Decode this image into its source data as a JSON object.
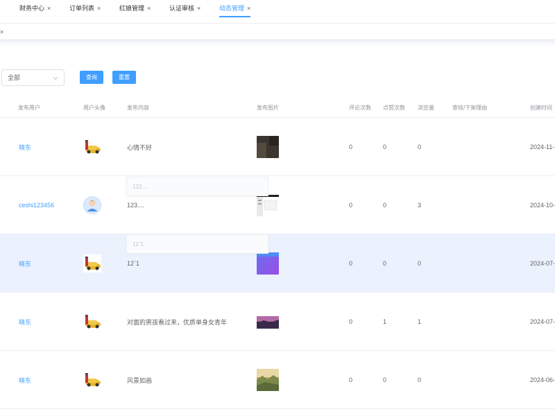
{
  "tabs": [
    {
      "label": "财务中心",
      "active": false
    },
    {
      "label": "订单列表",
      "active": false
    },
    {
      "label": "红娘管理",
      "active": false
    },
    {
      "label": "认证审核",
      "active": false
    },
    {
      "label": "动态管理",
      "active": true
    }
  ],
  "tab_close_glyph": "×",
  "filter": {
    "select_value": "全部",
    "query_button": "查询",
    "reset_button": "重置"
  },
  "table": {
    "headers": {
      "user": "发布用户",
      "avatar": "用户头像",
      "content": "发布内容",
      "images": "发布图片",
      "comments": "评论次数",
      "likes": "点赞次数",
      "views": "浏览量",
      "audit_reason": "审核/下架理由",
      "created": "创建时间"
    },
    "rows": [
      {
        "user": "晓东",
        "avatar": "car-avatar",
        "content": "心情不好",
        "image": "dark-photo",
        "comments": "0",
        "likes": "0",
        "views": "0",
        "created": "2024-11-"
      },
      {
        "user": "ceshi123456",
        "avatar": "person-avatar",
        "content": "123....",
        "image": "screenshot-photo",
        "comments": "0",
        "likes": "0",
        "views": "3",
        "created": "2024-10-"
      },
      {
        "user": "晓东",
        "avatar": "car-avatar",
        "content": "12`1",
        "image": "gradient-photo",
        "comments": "0",
        "likes": "0",
        "views": "0",
        "created": "2024-07-"
      },
      {
        "user": "晓东",
        "avatar": "car-avatar",
        "content": "对面的男孩看过来，优质单身女青年",
        "image": "dusk-photo",
        "comments": "0",
        "likes": "1",
        "views": "1",
        "created": "2024-07-"
      },
      {
        "user": "晓东",
        "avatar": "car-avatar",
        "content": "风景如画",
        "image": "landscape-photo",
        "comments": "0",
        "likes": "0",
        "views": "0",
        "created": "2024-06-"
      }
    ]
  },
  "tooltips": {
    "row2_content": "123....",
    "row3_content": "12`1"
  },
  "colors": {
    "primary": "#409eff",
    "highlight_row": "#ecf2fd"
  }
}
